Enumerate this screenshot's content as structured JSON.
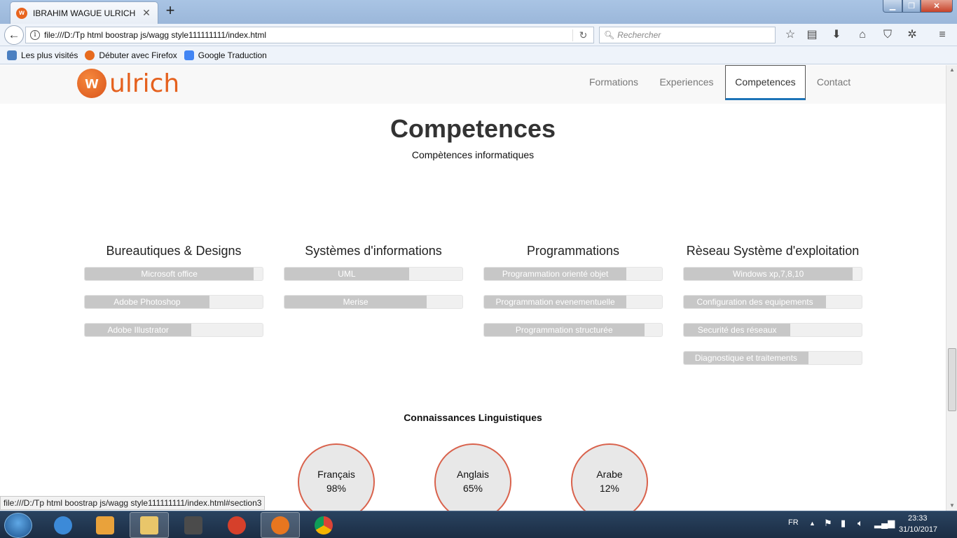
{
  "browser": {
    "tab_title": "IBRAHIM WAGUE ULRICH",
    "url": "file:///D:/Tp html boostrap js/wagg style111111111/index.html",
    "search_placeholder": "Rechercher",
    "bookmarks": [
      "Les plus visités",
      "Débuter avec Firefox",
      "Google Traduction"
    ],
    "status_url": "file:///D:/Tp html boostrap js/wagg style111111111/index.html#section3"
  },
  "site": {
    "logo_letter": "w",
    "logo_text": "ulrich",
    "nav": [
      "Formations",
      "Experiences",
      "Competences",
      "Contact"
    ],
    "active_nav": "Competences"
  },
  "section": {
    "title": "Competences",
    "subtitle": "Compètences informatiques"
  },
  "skill_groups": [
    {
      "title": "Bureautiques & Designs",
      "skills": [
        {
          "label": "Microsoft office",
          "level": 0.95
        },
        {
          "label": "Adobe Photoshop",
          "level": 0.7
        },
        {
          "label": "Adobe Illustrator",
          "level": 0.6
        }
      ]
    },
    {
      "title": "Systèmes d'informations",
      "skills": [
        {
          "label": "UML",
          "level": 0.7
        },
        {
          "label": "Merise",
          "level": 0.8
        }
      ]
    },
    {
      "title": "Programmations",
      "skills": [
        {
          "label": "Programmation orienté objet",
          "level": 0.8
        },
        {
          "label": "Programmation evenementuelle",
          "level": 0.8
        },
        {
          "label": "Programmation structurée",
          "level": 0.9
        }
      ]
    },
    {
      "title": "Rèseau Système d'exploitation",
      "skills": [
        {
          "label": "Windows xp,7,8,10",
          "level": 0.95
        },
        {
          "label": "Configuration des equipements",
          "level": 0.8
        },
        {
          "label": "Securité des réseaux",
          "level": 0.6
        },
        {
          "label": "Diagnostique et traitements",
          "level": 0.7
        }
      ]
    }
  ],
  "languages": {
    "title": "Connaissances Linguistiques",
    "items": [
      {
        "name": "Français",
        "value": "98%"
      },
      {
        "name": "Anglais",
        "value": "65%"
      },
      {
        "name": "Arabe",
        "value": "12%"
      }
    ]
  },
  "taskbar": {
    "lang": "FR",
    "time": "23:33",
    "date": "31/10/2017"
  }
}
